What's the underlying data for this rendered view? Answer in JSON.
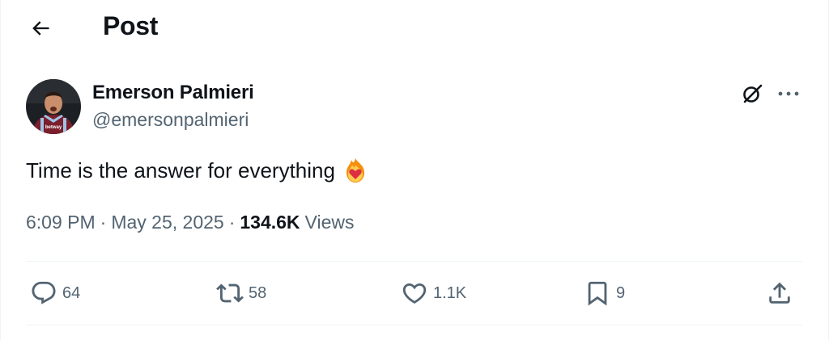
{
  "header": {
    "title": "Post",
    "back_icon": "arrow-left-icon"
  },
  "author": {
    "name": "Emerson Palmieri",
    "handle": "@emersonpalmieri",
    "avatar_icon": "avatar",
    "avatar_shirt_text": "betway"
  },
  "top_actions": {
    "grok_icon": "grok-icon",
    "more_icon": "more-horizontal-icon"
  },
  "post": {
    "text": "Time is the answer for everything",
    "emoji": "heart-on-fire-emoji"
  },
  "meta": {
    "time": "6:09 PM",
    "separator": "·",
    "date": "May 25, 2025",
    "views_count": "134.6K",
    "views_label": "Views"
  },
  "actions": {
    "replies": "64",
    "reposts": "58",
    "likes": "1.1K",
    "bookmarks": "9"
  },
  "colors": {
    "text_primary": "#0f1419",
    "text_secondary": "#536471",
    "divider": "#eff3f4"
  }
}
